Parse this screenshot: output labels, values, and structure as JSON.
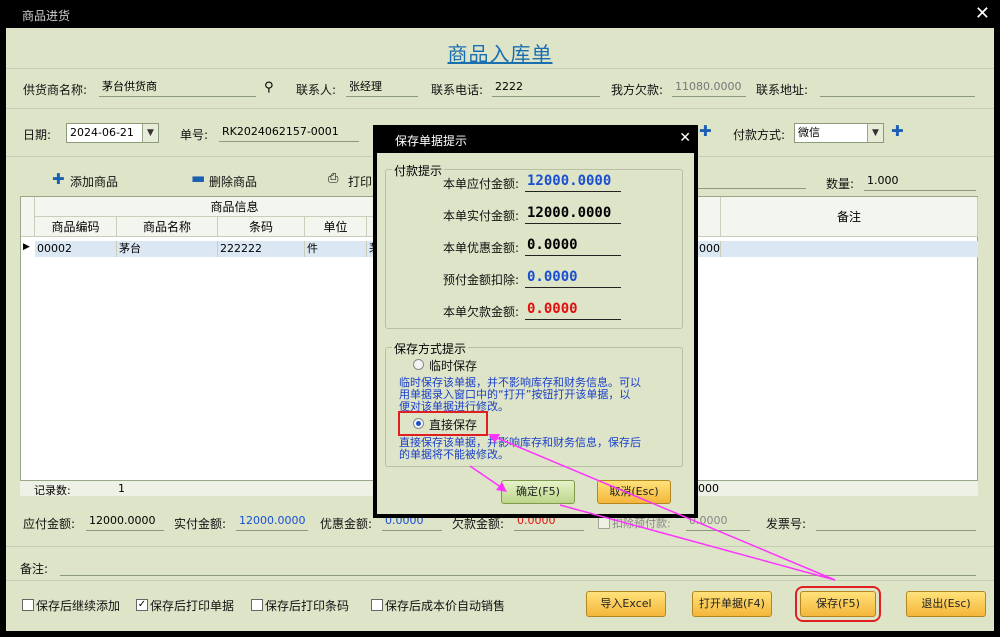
{
  "window": {
    "title": "商品进货",
    "close_glyph": "✕"
  },
  "heading": "商品入库单",
  "row1": {
    "supplier_label": "供货商名称:",
    "supplier_value": "茅台供货商",
    "contact_label": "联系人:",
    "contact_value": "张经理",
    "phone_label": "联系电话:",
    "phone_value": "2222",
    "debt_label": "我方欠款:",
    "debt_value": "11080.0000",
    "address_label": "联系地址:",
    "address_value": ""
  },
  "row2": {
    "date_label": "日期:",
    "date_value": "2024-06-21",
    "order_label": "单号:",
    "order_value": "RK2024062157-0001",
    "payment_label": "付款方式:",
    "payment_value": "微信"
  },
  "toolbar": {
    "add_label": "添加商品",
    "delete_label": "删除商品",
    "print_label": "打印",
    "qty_label": "数量:",
    "qty_value": "1.000"
  },
  "grid": {
    "group_header": "商品信息",
    "columns": [
      "商品编码",
      "商品名称",
      "条码",
      "单位"
    ],
    "remark_header": "备注",
    "row": {
      "code": "00002",
      "name": "茅台",
      "barcode": "222222",
      "unit": "件",
      "partial": "茅",
      "amount_partial": "000"
    },
    "footer_label": "记录数:",
    "footer_count": "1",
    "footer_amount_partial": "000"
  },
  "totals": {
    "payable_label": "应付金额:",
    "payable_value": "12000.0000",
    "paid_label": "实付金额:",
    "paid_value": "12000.0000",
    "discount_label": "优惠金额:",
    "discount_value": "0.0000",
    "owed_label": "欠款金额:",
    "owed_value": "0.0000",
    "prepay_label": "扣除预付款:",
    "prepay_value": "0.0000",
    "invoice_label": "发票号:",
    "invoice_value": ""
  },
  "remark_label": "备注:",
  "checkboxes": [
    {
      "label": "保存后继续添加",
      "checked": false
    },
    {
      "label": "保存后打印单据",
      "checked": true
    },
    {
      "label": "保存后打印条码",
      "checked": false
    },
    {
      "label": "保存后成本价自动销售",
      "checked": false
    }
  ],
  "buttons": {
    "import": "导入Excel",
    "open": "打开单据(F4)",
    "save": "保存(F5)",
    "exit": "退出(Esc)"
  },
  "dialog": {
    "title": "保存单据提示",
    "close_glyph": "✕",
    "pay_group": "付款提示",
    "payable_label": "本单应付金额:",
    "payable_value": "12000.0000",
    "paid_label": "本单实付金额:",
    "paid_value": "12000.0000",
    "discount_label": "本单优惠金额:",
    "discount_value": "0.0000",
    "prepay_label": "预付金额扣除:",
    "prepay_value": "0.0000",
    "owed_label": "本单欠款金额:",
    "owed_value": "0.0000",
    "mode_group": "保存方式提示",
    "temp_label": "临时保存",
    "temp_desc_1": "临时保存该单据，并不影响库存和财务信息。可以",
    "temp_desc_2": "用单据录入窗口中的“打开”按钮打开该单据，以",
    "temp_desc_3": "便对该单据进行修改。",
    "direct_label": "直接保存",
    "direct_desc_1": "直接保存该单据，并影响库存和财务信息，保存后",
    "direct_desc_2": "的单据将不能被修改。",
    "ok": "确定(F5)",
    "cancel": "取消(Esc)"
  },
  "colors": {
    "accent": "#1a6fb0",
    "highlight": "#e02020",
    "arrow": "#ff33ff"
  }
}
